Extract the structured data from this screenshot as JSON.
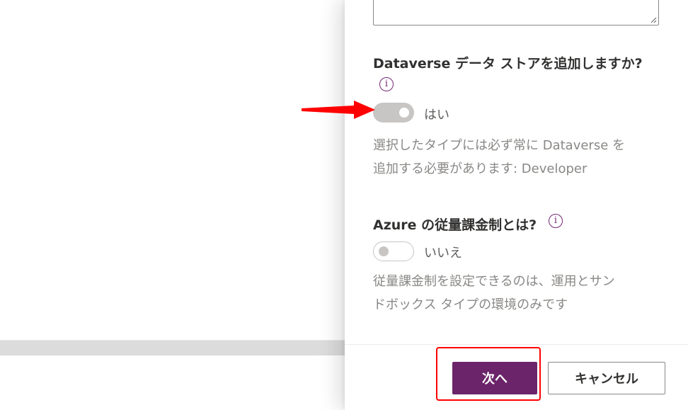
{
  "dataverse_section": {
    "title": "Dataverse データ ストアを追加しますか?",
    "info_icon": "info-icon",
    "toggle_state": "on",
    "toggle_label": "はい",
    "hint_line1": "選択したタイプには必ず常に Dataverse を",
    "hint_line2": "追加する必要があります: Developer"
  },
  "azure_section": {
    "title": "Azure の従量課金制とは?",
    "info_icon": "info-icon",
    "toggle_state": "off",
    "toggle_label": "いいえ",
    "hint_line1": "従量課金制を設定できるのは、運用とサン",
    "hint_line2": "ドボックス タイプの環境のみです"
  },
  "footer": {
    "next_label": "次へ",
    "cancel_label": "キャンセル"
  },
  "annotations": {
    "arrow_color": "#ff0000",
    "highlight_color": "#ff0000"
  },
  "colors": {
    "accent": "#6b2469",
    "info_icon": "#742774",
    "toggle_disabled": "#c8c6c4",
    "hint_text": "#8a8886"
  }
}
